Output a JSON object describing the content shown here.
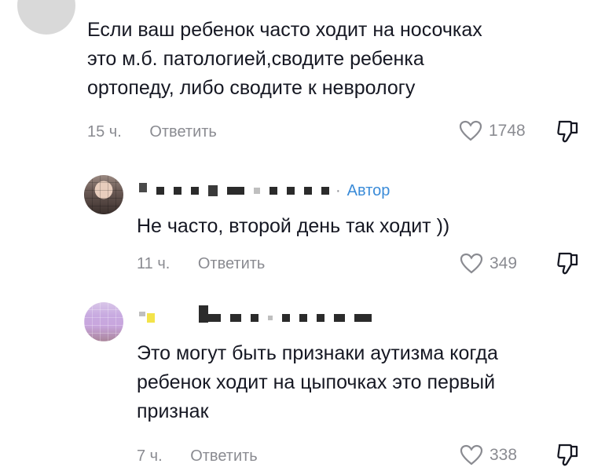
{
  "comments": [
    {
      "text": "Если ваш ребенок часто ходит на носочках\nэто м.б. патологией,сводите ребенка\nортопеду, либо сводите к неврологу",
      "time": "15 ч.",
      "reply_label": "Ответить",
      "likes": "1748"
    },
    {
      "author_tag": "Автор",
      "author_dot": "·",
      "text": "Не часто, второй день так ходит ))",
      "time": "11 ч.",
      "reply_label": "Ответить",
      "likes": "349"
    },
    {
      "text": "Это могут быть признаки аутизма когда\nребенок ходит на цыпочках это первый\nпризнак",
      "time": "7 ч.",
      "reply_label": "Ответить",
      "likes": "338"
    }
  ],
  "colors": {
    "text": "#161823",
    "muted": "#8a8b91",
    "author_accent": "#3a8bd8"
  },
  "icons": [
    "avatar",
    "heart-icon",
    "dislike-icon"
  ]
}
